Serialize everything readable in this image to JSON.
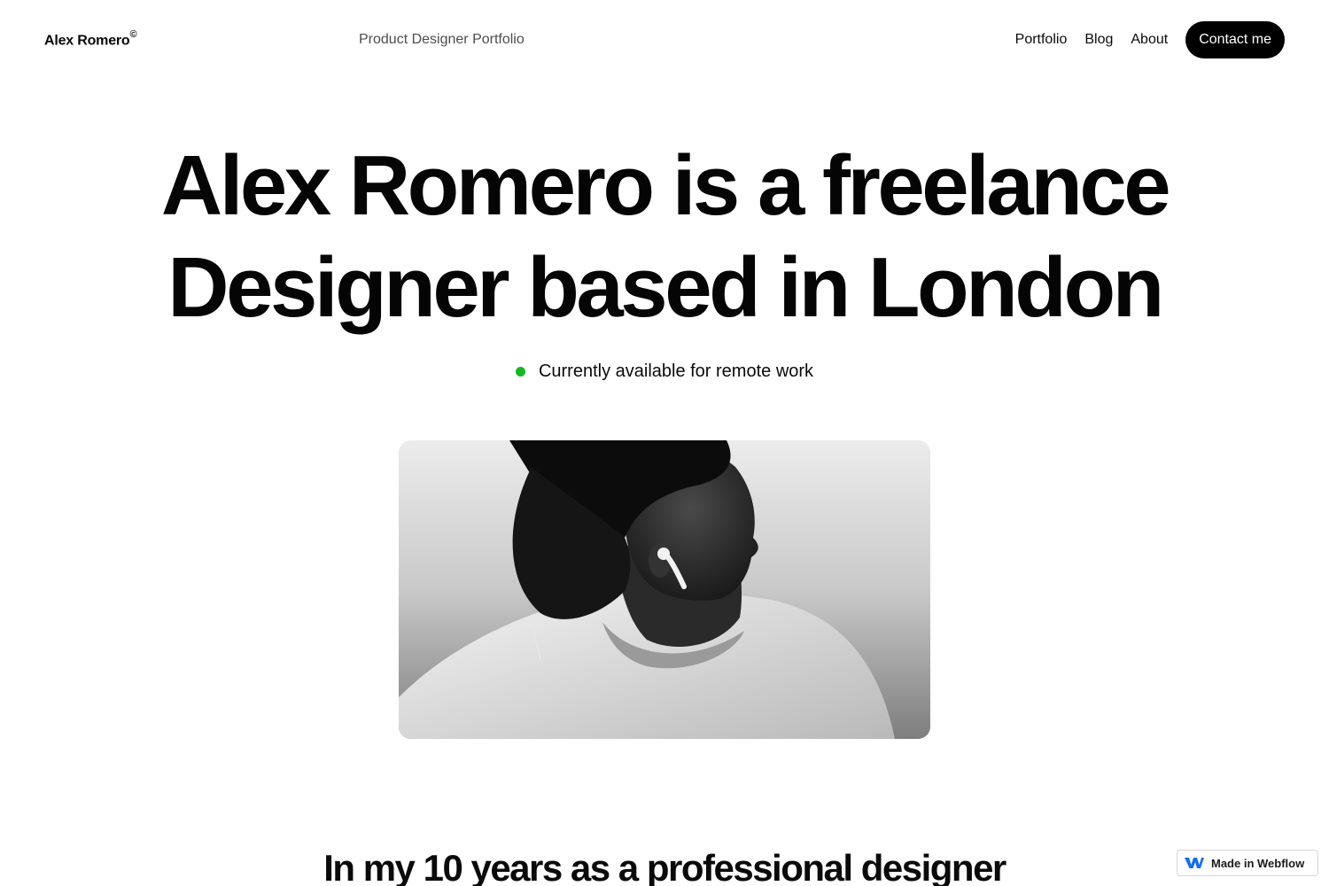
{
  "header": {
    "brand": "Alex Romero",
    "brand_mark": "©",
    "tagline": "Product Designer Portfolio",
    "nav": [
      {
        "label": "Portfolio"
      },
      {
        "label": "Blog"
      },
      {
        "label": "About"
      }
    ],
    "cta_label": "Contact me"
  },
  "hero": {
    "title_line1": "Alex Romero is a freelance",
    "title_line2": "Designer based in London",
    "availability": "Currently available for remote work",
    "status_color": "#14b821"
  },
  "intro": {
    "title": "In my 10 years as a professional designer"
  },
  "badge": {
    "label": "Made in Webflow",
    "icon": "webflow-logo"
  },
  "colors": {
    "text": "#0a0a0a",
    "button_bg": "#000000",
    "button_text": "#ffffff",
    "background": "#ffffff"
  }
}
